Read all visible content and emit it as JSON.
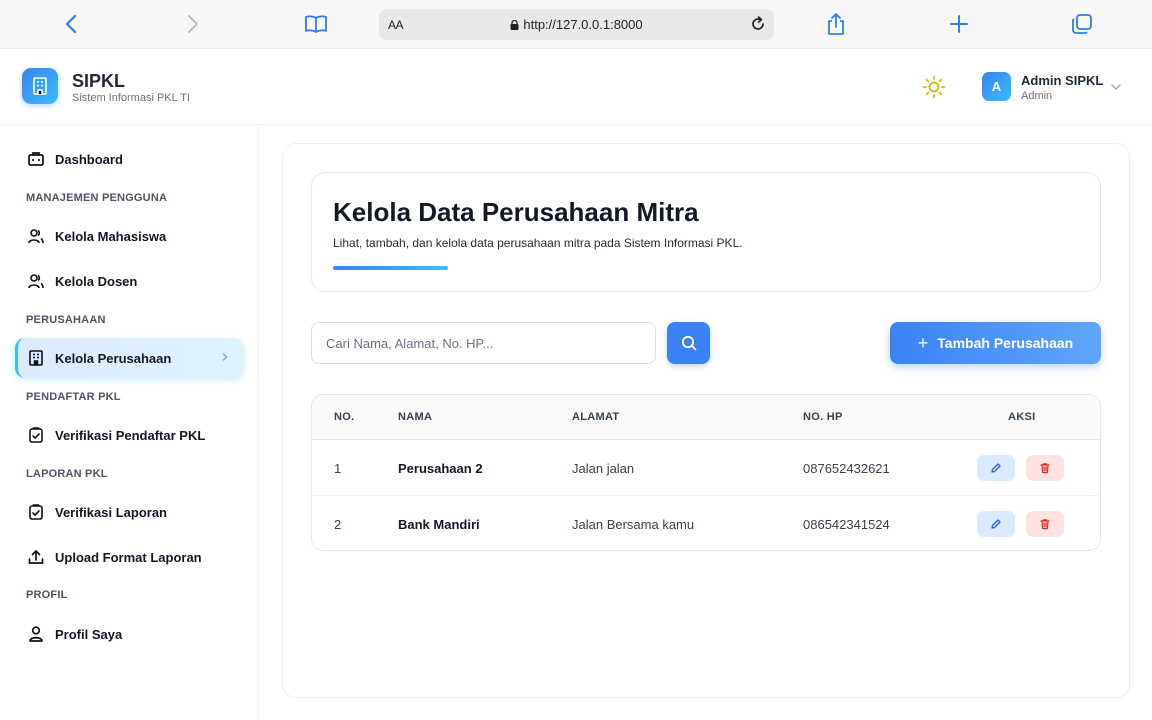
{
  "browser": {
    "url": "http://127.0.0.1:8000",
    "reader_label": "AA"
  },
  "header": {
    "app_name": "SIPKL",
    "app_subtitle": "Sistem Informasi PKL TI",
    "user_initial": "A",
    "user_name": "Admin SIPKL",
    "user_role": "Admin"
  },
  "sidebar": {
    "dashboard": "Dashboard",
    "sections": {
      "manajemen": "MANAJEMEN PENGGUNA",
      "perusahaan": "PERUSAHAAN",
      "pendaftar": "PENDAFTAR PKL",
      "laporan": "LAPORAN PKL",
      "profil": "PROFIL"
    },
    "items": {
      "mahasiswa": "Kelola Mahasiswa",
      "dosen": "Kelola Dosen",
      "perusahaan": "Kelola Perusahaan",
      "verif_pendaftar": "Verifikasi Pendaftar PKL",
      "verif_laporan": "Verifikasi Laporan",
      "upload_format": "Upload Format Laporan",
      "profil_saya": "Profil Saya"
    }
  },
  "main": {
    "title": "Kelola Data Perusahaan Mitra",
    "description": "Lihat, tambah, dan kelola data perusahaan mitra pada Sistem Informasi PKL.",
    "search_placeholder": "Cari Nama, Alamat, No. HP...",
    "add_label": "Tambah Perusahaan",
    "add_plus": "+"
  },
  "table": {
    "headers": {
      "no": "NO.",
      "nama": "NAMA",
      "alamat": "ALAMAT",
      "hp": "NO. HP",
      "aksi": "AKSI"
    },
    "rows": [
      {
        "no": "1",
        "nama": "Perusahaan 2",
        "alamat": "Jalan jalan",
        "hp": "087652432621"
      },
      {
        "no": "2",
        "nama": "Bank Mandiri",
        "alamat": "Jalan Bersama kamu",
        "hp": "086542341524"
      }
    ]
  },
  "colors": {
    "accent": "#3b82f6",
    "accent_light": "#38bdf8",
    "danger": "#ef4444"
  }
}
